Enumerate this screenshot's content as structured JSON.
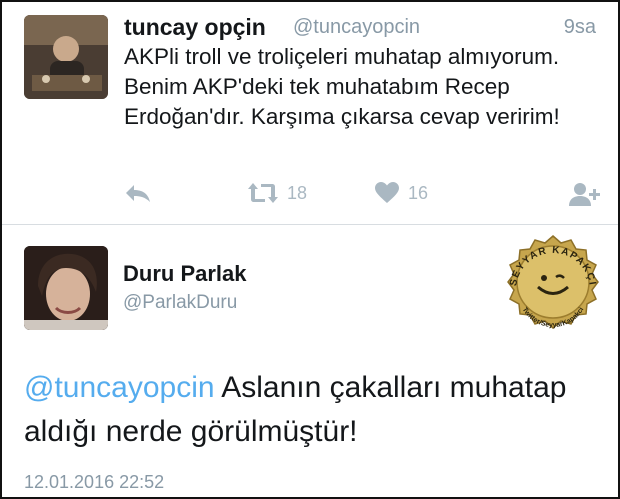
{
  "tweet1": {
    "name": "tuncay opçin",
    "handle": "@tuncayopcin",
    "time": "9sa",
    "text": "AKPli troll ve troliçeleri muhatap almıyorum. Benim AKP'deki tek muhatabım Recep Erdoğan'dır. Karşıma çıkarsa cevap veririm!",
    "actions": {
      "retweet_count": "18",
      "like_count": "16"
    },
    "icons": [
      "reply-icon",
      "retweet-icon",
      "heart-icon",
      "follow-icon"
    ]
  },
  "tweet2": {
    "name": "Duru Parlak",
    "handle": "@ParlakDuru",
    "mention": "@tuncayopcin",
    "text": " Aslanın çakalları muhatap aldığı nerde görülmüştür!",
    "date": "12.01.2016 22:52"
  },
  "watermark": {
    "top_text": "SEYYAR KAPAKÇI",
    "bottom_text": "Twitter/SeyyarKapakci"
  },
  "colors": {
    "accent": "#55acee",
    "muted": "#8899a6",
    "icon": "#aab8c2",
    "text": "#14171a"
  }
}
